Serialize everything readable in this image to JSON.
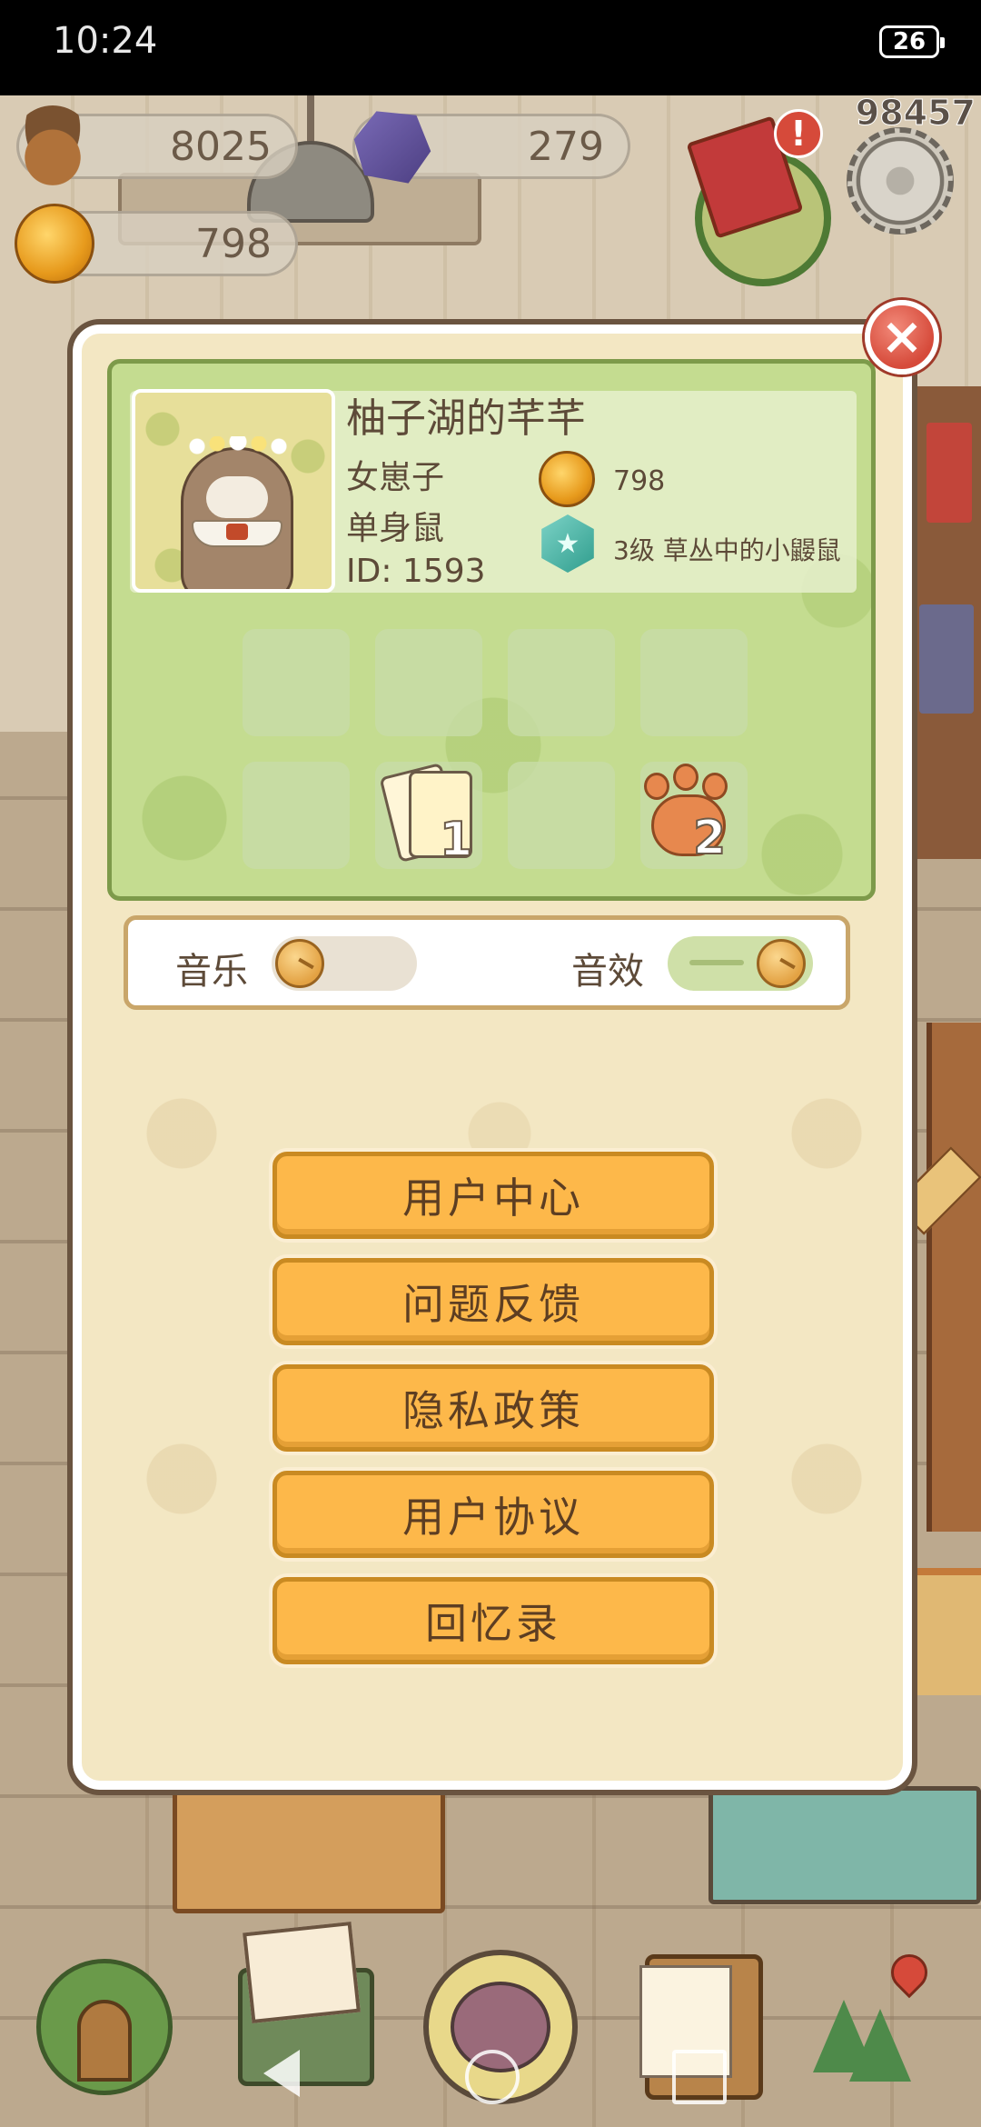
{
  "status_bar": {
    "time": "10:24",
    "battery": "26"
  },
  "resources": {
    "acorns": "8025",
    "crystals": "279",
    "bells": "798",
    "score": "98457",
    "alert": "!"
  },
  "profile": {
    "name": "柚子湖的芊芊",
    "title_1": "女崽子",
    "title_2": "单身鼠",
    "id": "ID: 1593",
    "bells": "798",
    "level_text": "3级 草丛中的小鼹鼠",
    "items": [
      {
        "icon": "cards-icon",
        "count": "1"
      },
      {
        "icon": "paw-icon",
        "count": "2"
      }
    ]
  },
  "settings": {
    "music_label": "音乐",
    "music_on": false,
    "sfx_label": "音效",
    "sfx_on": true
  },
  "menu": {
    "user_center": "用户中心",
    "feedback": "问题反馈",
    "privacy": "隐私政策",
    "agreement": "用户协议",
    "memoir": "回忆录"
  },
  "close_label": "×",
  "colors": {
    "button_fill": "#fdb84a",
    "panel_green": "#c4dc90",
    "dialog_bg": "#f3e7c3"
  }
}
